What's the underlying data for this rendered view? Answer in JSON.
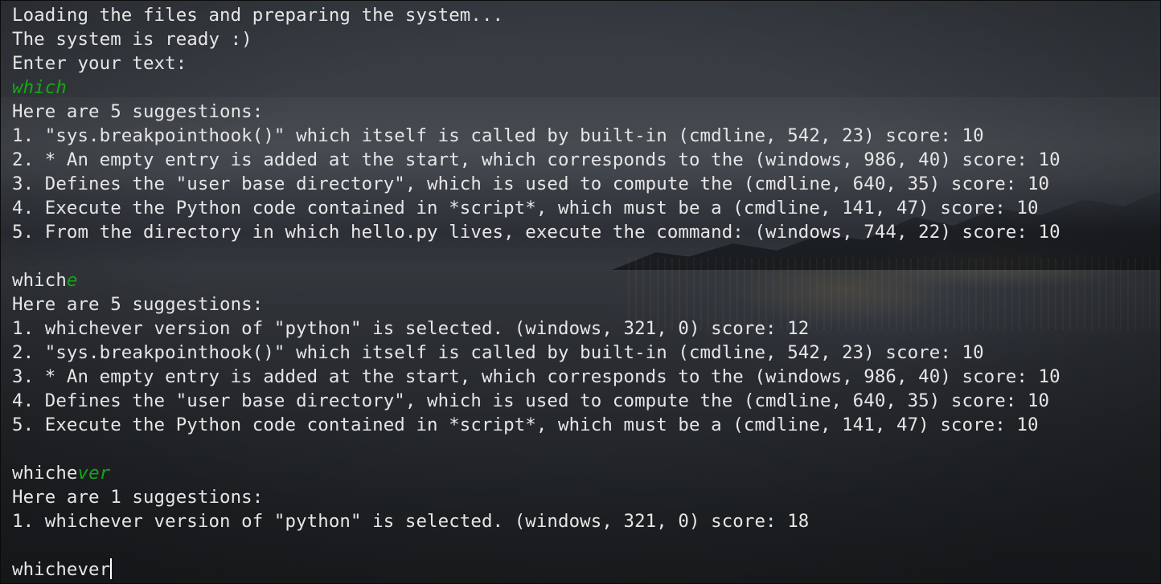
{
  "terminal": {
    "loading": "Loading the files and preparing the system...",
    "ready": "The system is ready :)",
    "prompt": "Enter your text:",
    "colors": {
      "text": "#e6e6e6",
      "suggestion": "#17a617",
      "cursor": "#ffffff"
    },
    "queries": [
      {
        "typed": "",
        "completion": "which",
        "header": "Here are 5 suggestions:",
        "suggestions": [
          "1. \"sys.breakpointhook()\" which itself is called by built-in (cmdline, 542, 23) score: 10",
          "2. * An empty entry is added at the start, which corresponds to the (windows, 986, 40) score: 10",
          "3. Defines the \"user base directory\", which is used to compute the (cmdline, 640, 35) score: 10",
          "4. Execute the Python code contained in *script*, which must be a (cmdline, 141, 47) score: 10",
          "5. From the directory in which hello.py lives, execute the command: (windows, 744, 22) score: 10"
        ]
      },
      {
        "typed": "which",
        "completion": "e",
        "header": "Here are 5 suggestions:",
        "suggestions": [
          "1. whichever version of \"python\" is selected. (windows, 321, 0) score: 12",
          "2. \"sys.breakpointhook()\" which itself is called by built-in (cmdline, 542, 23) score: 10",
          "3. * An empty entry is added at the start, which corresponds to the (windows, 986, 40) score: 10",
          "4. Defines the \"user base directory\", which is used to compute the (cmdline, 640, 35) score: 10",
          "5. Execute the Python code contained in *script*, which must be a (cmdline, 141, 47) score: 10"
        ]
      },
      {
        "typed": "whiche",
        "completion": "ver",
        "header": "Here are 1 suggestions:",
        "suggestions": [
          "1. whichever version of \"python\" is selected. (windows, 321, 0) score: 18"
        ]
      }
    ],
    "current_input": "whichever"
  }
}
